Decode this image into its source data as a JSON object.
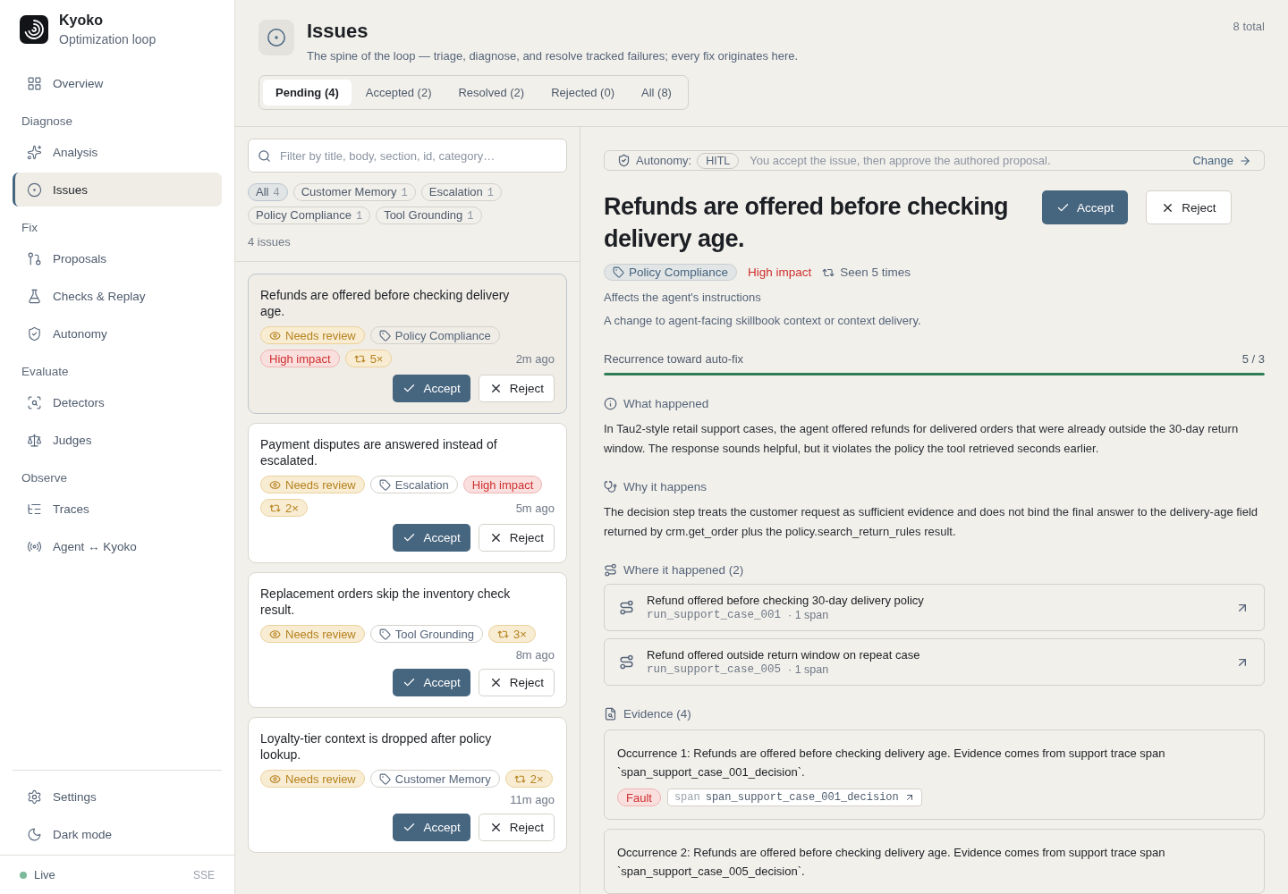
{
  "brand": {
    "name": "Kyoko",
    "subtitle": "Optimization loop"
  },
  "nav_groups": [
    {
      "items": [
        {
          "label": "Overview",
          "selected": false
        }
      ]
    },
    {
      "heading": "Diagnose",
      "items": [
        {
          "label": "Analysis",
          "selected": false
        },
        {
          "label": "Issues",
          "selected": true
        }
      ]
    },
    {
      "heading": "Fix",
      "items": [
        {
          "label": "Proposals",
          "selected": false
        },
        {
          "label": "Checks & Replay",
          "selected": false
        },
        {
          "label": "Autonomy",
          "selected": false
        }
      ]
    },
    {
      "heading": "Evaluate",
      "items": [
        {
          "label": "Detectors",
          "selected": false
        },
        {
          "label": "Judges",
          "selected": false
        }
      ]
    },
    {
      "heading": "Observe",
      "items": [
        {
          "label": "Traces",
          "selected": false
        },
        {
          "label": "Agent ↔ Kyoko",
          "selected": false
        }
      ]
    }
  ],
  "footer_items": [
    "Settings",
    "Dark mode"
  ],
  "connection": {
    "status": "Live",
    "transport": "SSE"
  },
  "header": {
    "title": "Issues",
    "description": "The spine of the loop — triage, diagnose, and resolve tracked failures; every fix originates here.",
    "total": "8 total"
  },
  "tabs": [
    {
      "label": "Pending (4)",
      "selected": true
    },
    {
      "label": "Accepted (2)",
      "selected": false
    },
    {
      "label": "Resolved (2)",
      "selected": false
    },
    {
      "label": "Rejected (0)",
      "selected": false
    },
    {
      "label": "All (8)",
      "selected": false
    }
  ],
  "filter": {
    "placeholder": "Filter by title, body, section, id, category…",
    "chips": [
      {
        "label": "All",
        "count": "4",
        "selected": true
      },
      {
        "label": "Customer Memory",
        "count": "1",
        "selected": false
      },
      {
        "label": "Escalation",
        "count": "1",
        "selected": false
      },
      {
        "label": "Policy Compliance",
        "count": "1",
        "selected": false
      },
      {
        "label": "Tool Grounding",
        "count": "1",
        "selected": false
      }
    ],
    "result_count": "4 issues"
  },
  "issues": [
    {
      "title": "Refunds are offered before checking delivery age.",
      "status": "Needs review",
      "category": "Policy Compliance",
      "impact": "High impact",
      "recurrence": "5×",
      "time": "2m ago",
      "selected": true,
      "accept": "Accept",
      "reject": "Reject"
    },
    {
      "title": "Payment disputes are answered instead of escalated.",
      "status": "Needs review",
      "category": "Escalation",
      "impact": "High impact",
      "recurrence": "2×",
      "time": "5m ago",
      "selected": false,
      "accept": "Accept",
      "reject": "Reject"
    },
    {
      "title": "Replacement orders skip the inventory check result.",
      "status": "Needs review",
      "category": "Tool Grounding",
      "recurrence": "3×",
      "time": "8m ago",
      "selected": false,
      "accept": "Accept",
      "reject": "Reject"
    },
    {
      "title": "Loyalty-tier context is dropped after policy lookup.",
      "status": "Needs review",
      "category": "Customer Memory",
      "recurrence": "2×",
      "time": "11m ago",
      "selected": false,
      "accept": "Accept",
      "reject": "Reject"
    }
  ],
  "detail": {
    "autonomy": {
      "label": "Autonomy:",
      "mode": "HITL",
      "text": "You accept the issue, then approve the authored proposal.",
      "action": "Change"
    },
    "title": "Refunds are offered before checking delivery age.",
    "accept": "Accept",
    "reject": "Reject",
    "category": "Policy Compliance",
    "impact": "High impact",
    "seen": "Seen 5 times",
    "affects": "Affects the agent's instructions",
    "change_note": "A change to agent-facing skillbook context or context delivery.",
    "recurrence": {
      "label": "Recurrence toward auto-fix",
      "reading": "5 / 3",
      "level": 1
    },
    "what_happened": {
      "heading": "What happened",
      "body": "In Tau2-style retail support cases, the agent offered refunds for delivered orders that were already outside the 30-day return window. The response sounds helpful, but it violates the policy the tool retrieved seconds earlier."
    },
    "why": {
      "heading": "Why it happens",
      "body": "The decision step treats the customer request as sufficient evidence and does not bind the final answer to the delivery-age field returned by crm.get_order plus the policy.search_return_rules result."
    },
    "where": {
      "heading": "Where it happened (2)",
      "items": [
        {
          "title": "Refund offered before checking 30-day delivery policy",
          "run": "run_support_case_001",
          "spans": "· 1 span"
        },
        {
          "title": "Refund offered outside return window on repeat case",
          "run": "run_support_case_005",
          "spans": "· 1 span"
        }
      ]
    },
    "evidence": {
      "heading": "Evidence (4)",
      "items": [
        {
          "text": "Occurrence 1: Refunds are offered before checking delivery age. Evidence comes from support trace span `span_support_case_001_decision`.",
          "tag": "Fault",
          "span_label": "span",
          "span_id": "span_support_case_001_decision"
        },
        {
          "text": "Occurrence 2: Refunds are offered before checking delivery age. Evidence comes from support trace span `span_support_case_005_decision`."
        }
      ]
    }
  }
}
